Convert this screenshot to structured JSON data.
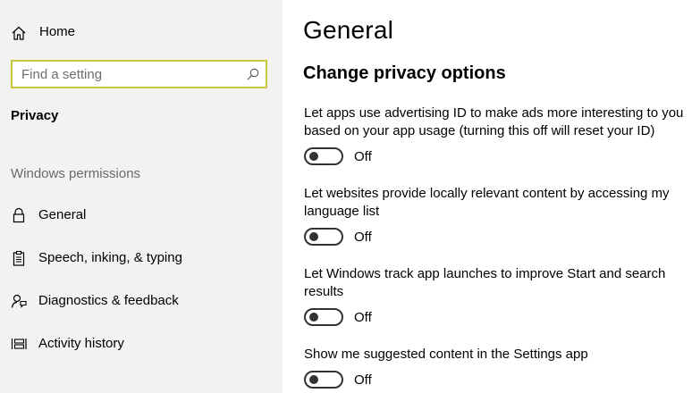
{
  "sidebar": {
    "home_label": "Home",
    "search": {
      "placeholder": "Find a setting",
      "value": ""
    },
    "section_title": "Privacy",
    "group_title": "Windows permissions",
    "items": [
      {
        "label": "General",
        "icon": "lock-icon"
      },
      {
        "label": "Speech, inking, & typing",
        "icon": "clipboard-icon"
      },
      {
        "label": "Diagnostics & feedback",
        "icon": "person-feedback-icon"
      },
      {
        "label": "Activity history",
        "icon": "activity-history-icon"
      }
    ]
  },
  "main": {
    "title": "General",
    "subtitle": "Change privacy options",
    "settings": [
      {
        "description": "Let apps use advertising ID to make ads more interesting to you based on your app usage (turning this off will reset your ID)",
        "state": "Off"
      },
      {
        "description": "Let websites provide locally relevant content by accessing my language list",
        "state": "Off"
      },
      {
        "description": "Let Windows track app launches to improve Start and search results",
        "state": "Off"
      },
      {
        "description": "Show me suggested content in the Settings app",
        "state": "Off"
      }
    ]
  },
  "colors": {
    "sidebar_bg": "#f2f2f2",
    "search_border": "#c8c83a",
    "toggle_off": "#333333",
    "muted_text": "#6a6a6a"
  }
}
